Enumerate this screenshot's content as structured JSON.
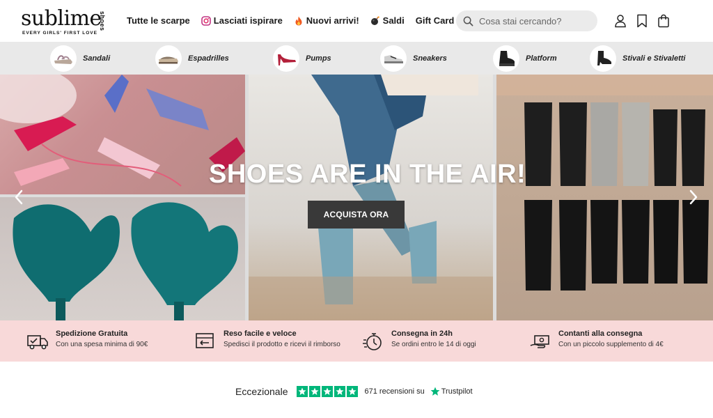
{
  "brand": {
    "name": "sublime",
    "suffix": "shoes",
    "tagline": "EVERY GIRLS' FIRST LOVE"
  },
  "nav": {
    "items": [
      {
        "label": "Tutte le scarpe",
        "icon": "none"
      },
      {
        "label": "Lasciati ispirare",
        "icon": "instagram-icon"
      },
      {
        "label": "Nuovi arrivi!",
        "icon": "fire-icon"
      },
      {
        "label": "Saldi",
        "icon": "bomb-icon"
      },
      {
        "label": "Gift Card",
        "icon": "none"
      }
    ]
  },
  "search": {
    "placeholder": "Cosa stai cercando?"
  },
  "categories": [
    {
      "label": "Sandali"
    },
    {
      "label": "Espadrilles"
    },
    {
      "label": "Pumps"
    },
    {
      "label": "Sneakers"
    },
    {
      "label": "Platform"
    },
    {
      "label": "Stivali e Stivaletti"
    }
  ],
  "hero": {
    "title": "SHOES ARE IN THE AIR!",
    "cta": "ACQUISTA ORA"
  },
  "features": [
    {
      "title": "Spedizione Gratuita",
      "desc": "Con una spesa minima di 90€",
      "icon": "truck-icon"
    },
    {
      "title": "Reso facile e veloce",
      "desc": "Spedisci il prodotto e ricevi il rimborso",
      "icon": "return-box-icon"
    },
    {
      "title": "Consegna in 24h",
      "desc": "Se ordini entro le 14 di oggi",
      "icon": "stopwatch-icon"
    },
    {
      "title": "Contanti alla consegna",
      "desc": "Con un piccolo supplemento di 4€",
      "icon": "cash-icon"
    }
  ],
  "trustpilot": {
    "rating_word": "Eccezionale",
    "stars": 5,
    "reviews": "671 recensioni su",
    "brand": "Trustpilot"
  },
  "colors": {
    "feature_bar": "#f8d9d9",
    "category_bar": "#e9e9e9",
    "cta": "#393939",
    "trustpilot_green": "#00b67a"
  }
}
